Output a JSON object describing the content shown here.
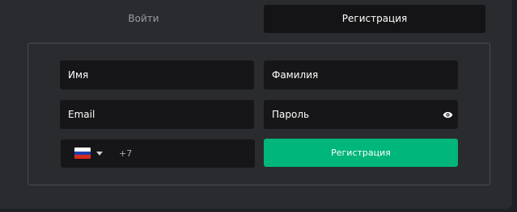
{
  "tabs": {
    "login_label": "Войти",
    "register_label": "Регистрация"
  },
  "form": {
    "name_placeholder": "Имя",
    "surname_placeholder": "Фамилия",
    "email_placeholder": "Email",
    "password_placeholder": "Пароль",
    "phone": {
      "country_icon": "russia-flag-icon",
      "code": "+7"
    },
    "submit_label": "Регистрация"
  },
  "colors": {
    "accent": "#00b67a",
    "background": "#2a2b2f",
    "field": "#161618"
  }
}
